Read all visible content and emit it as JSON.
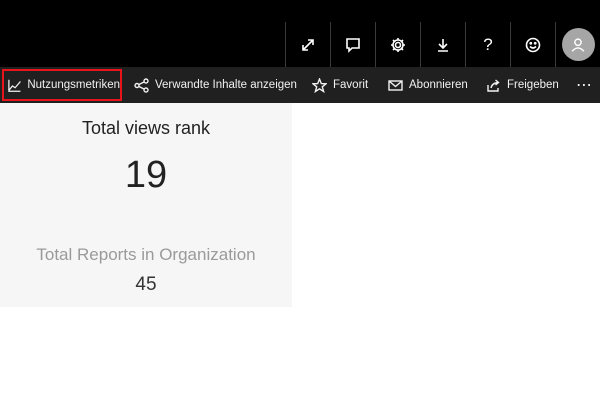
{
  "header": {
    "icons": [
      "expand-icon",
      "comment-icon",
      "gear-icon",
      "download-icon",
      "help-icon",
      "smiley-icon",
      "avatar-icon"
    ],
    "help_label": "?"
  },
  "actions": {
    "usage_metrics": "Nutzungsmetriken",
    "related_content": "Verwandte Inhalte anzeigen",
    "favorite": "Favorit",
    "subscribe": "Abonnieren",
    "share": "Freigeben",
    "more": "⋯"
  },
  "tile": {
    "title": "Total views rank",
    "value": "19",
    "subtitle": "Total Reports in Organization",
    "subvalue": "45"
  },
  "colors": {
    "header_bg": "#000000",
    "actionbar_bg": "#202020",
    "highlight": "#e8141b",
    "tile_bg": "#f6f6f6"
  }
}
